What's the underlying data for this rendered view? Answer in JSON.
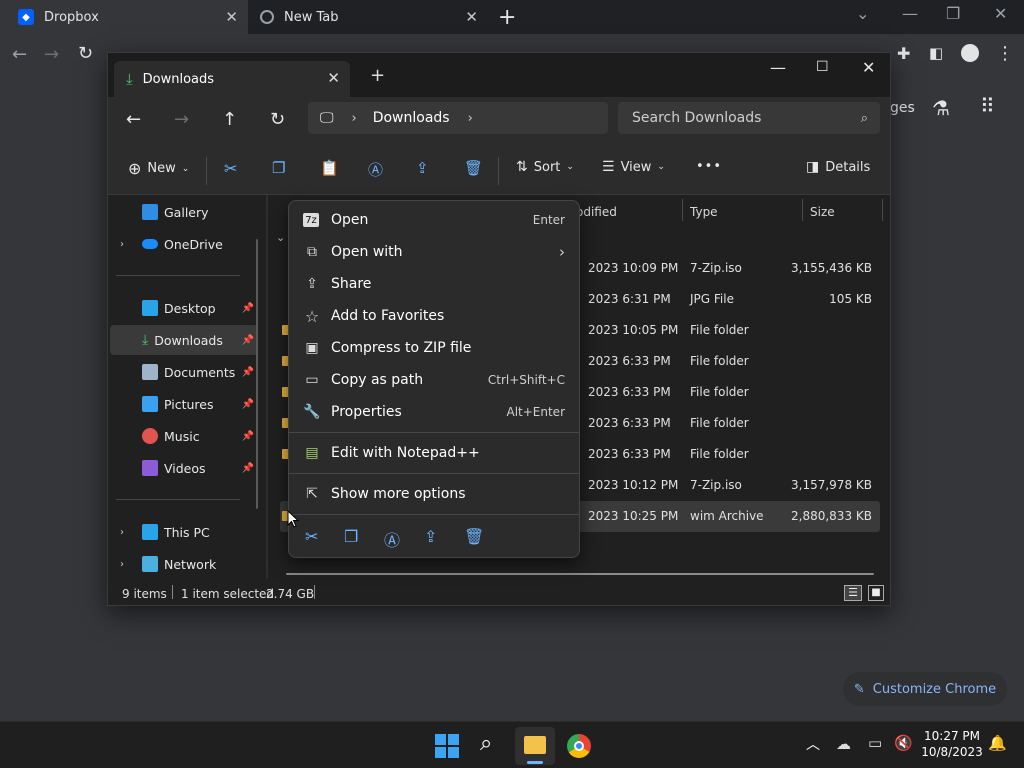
{
  "chrome": {
    "tabs": [
      {
        "title": "Dropbox"
      },
      {
        "title": "New Tab"
      }
    ],
    "new_tab_glyph": "+",
    "customize_label": "Customize Chrome",
    "partial_text": "ges"
  },
  "explorer": {
    "tab_title": "Downloads",
    "breadcrumb": "Downloads",
    "search_placeholder": "Search Downloads",
    "commands": {
      "new": "New",
      "sort": "Sort",
      "view": "View",
      "more": "•••",
      "details": "Details"
    },
    "sidebar": {
      "gallery": "Gallery",
      "onedrive": "OneDrive",
      "desktop": "Desktop",
      "downloads": "Downloads",
      "documents": "Documents",
      "pictures": "Pictures",
      "music": "Music",
      "videos": "Videos",
      "thispc": "This PC",
      "network": "Network"
    },
    "columns": {
      "modified": "odified",
      "type": "Type",
      "size": "Size"
    },
    "rows": [
      {
        "date": "2023 10:09 PM",
        "type": "7-Zip.iso",
        "size": "3,155,436 KB"
      },
      {
        "date": "2023 6:31 PM",
        "type": "JPG File",
        "size": "105 KB"
      },
      {
        "date": "2023 10:05 PM",
        "type": "File folder",
        "size": ""
      },
      {
        "date": "2023 6:33 PM",
        "type": "File folder",
        "size": ""
      },
      {
        "date": "2023 6:33 PM",
        "type": "File folder",
        "size": ""
      },
      {
        "date": "2023 6:33 PM",
        "type": "File folder",
        "size": ""
      },
      {
        "date": "2023 6:33 PM",
        "type": "File folder",
        "size": ""
      },
      {
        "date": "2023 10:12 PM",
        "type": "7-Zip.iso",
        "size": "3,157,978 KB"
      },
      {
        "date": "2023 10:25 PM",
        "type": "wim Archive",
        "size": "2,880,833 KB"
      }
    ],
    "status": {
      "items": "9 items",
      "selected": "1 item selected",
      "size": "2.74 GB"
    }
  },
  "context_menu": {
    "open": {
      "label": "Open",
      "shortcut": "Enter"
    },
    "open_with": {
      "label": "Open with"
    },
    "share": {
      "label": "Share"
    },
    "favorites": {
      "label": "Add to Favorites"
    },
    "compress": {
      "label": "Compress to ZIP file"
    },
    "copy_path": {
      "label": "Copy as path",
      "shortcut": "Ctrl+Shift+C"
    },
    "properties": {
      "label": "Properties",
      "shortcut": "Alt+Enter"
    },
    "notepad": {
      "label": "Edit with Notepad++"
    },
    "more_options": {
      "label": "Show more options"
    }
  },
  "taskbar": {
    "time": "10:27 PM",
    "date": "10/8/2023"
  },
  "colors": {
    "accent": "#6cb4ff",
    "folder": "#e8b53e",
    "chrome_link": "#8ab4f8"
  }
}
